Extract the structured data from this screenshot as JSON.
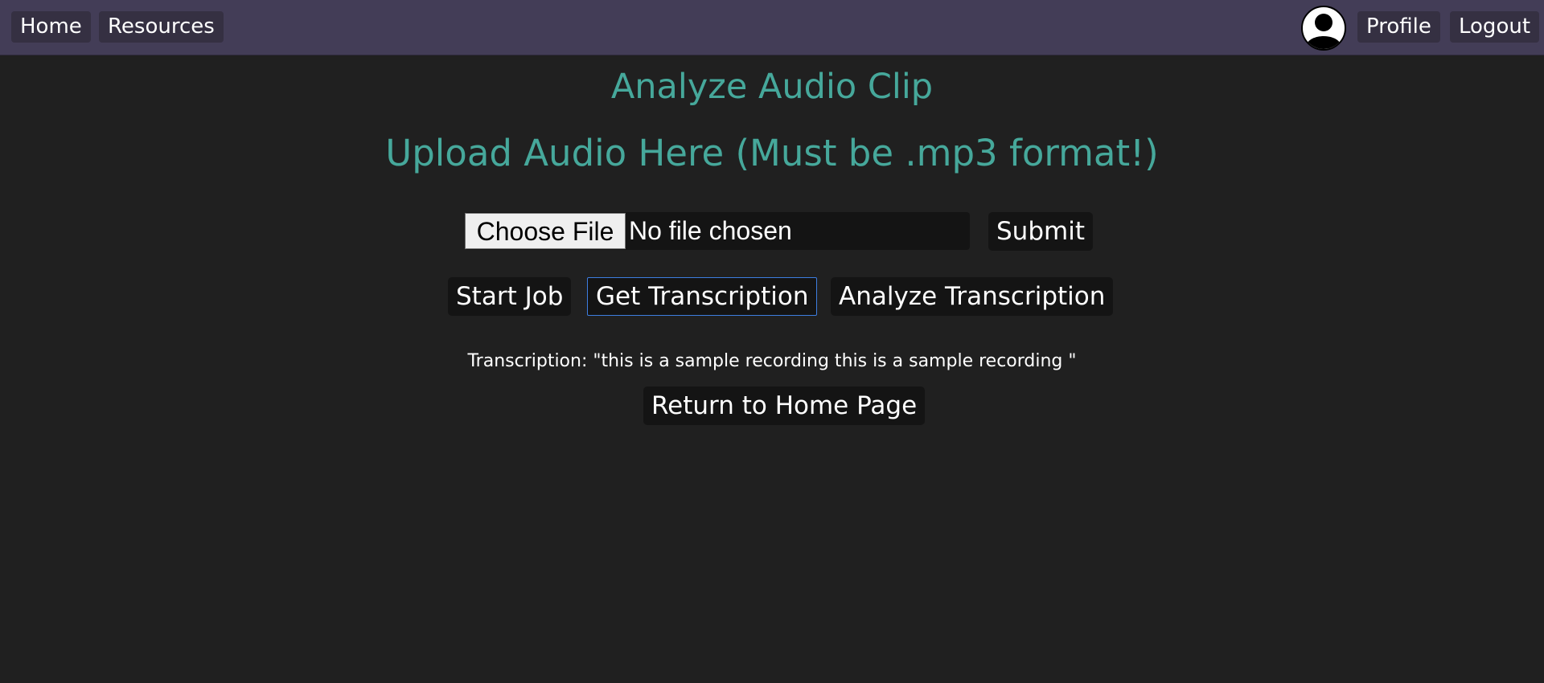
{
  "nav": {
    "home_label": "Home",
    "resources_label": "Resources",
    "profile_label": "Profile",
    "logout_label": "Logout",
    "avatar_icon": "user-avatar-icon"
  },
  "header": {
    "title": "Analyze Audio Clip",
    "subtitle": "Upload Audio Here (Must be .mp3 format!)"
  },
  "upload": {
    "choose_file_label": "Choose File",
    "file_status": "No file chosen",
    "submit_label": "Submit"
  },
  "actions": {
    "start_job_label": "Start Job",
    "get_transcription_label": "Get Transcription",
    "analyze_transcription_label": "Analyze Transcription"
  },
  "result": {
    "transcription_text": "Transcription: \"this is a sample recording this is a sample recording \""
  },
  "footer": {
    "return_home_label": "Return to Home Page"
  },
  "colors": {
    "navbar": "#433d57",
    "background": "#202020",
    "accent": "#46a89b",
    "focus_ring": "#3d7de0"
  }
}
